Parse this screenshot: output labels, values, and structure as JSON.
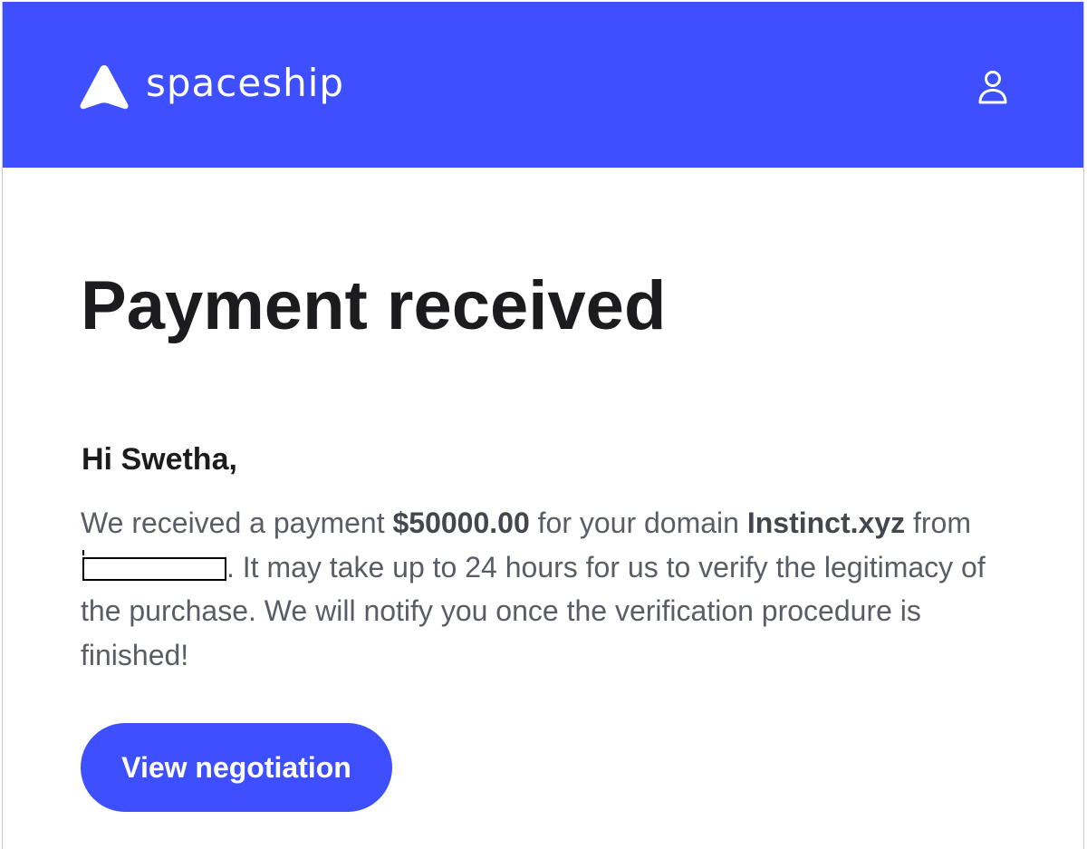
{
  "header": {
    "brand_name": "spaceship",
    "brand_color": "#3d4fff",
    "logo_icon": "spaceship-logo-icon",
    "account_icon": "user-icon"
  },
  "email": {
    "title": "Payment received",
    "greeting": "Hi Swetha,",
    "body": {
      "part1": "We received a payment ",
      "amount": "$50000.00",
      "part2": " for your domain ",
      "domain": "Instinct.xyz",
      "part3": " from ",
      "redacted_note": "[redacted]",
      "part4": ". It may take up to 24 hours for us to verify the legitimacy of the purchase. We will notify you once the verification procedure is finished!"
    },
    "cta_label": "View negotiation"
  }
}
